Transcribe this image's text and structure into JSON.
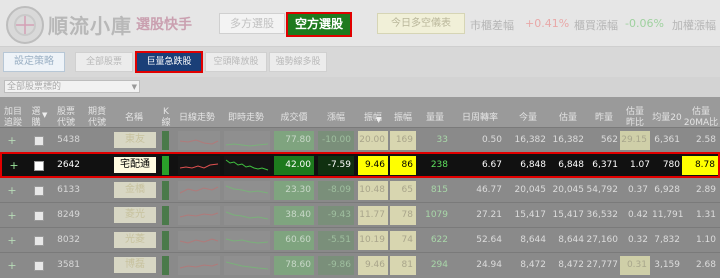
{
  "app": {
    "brand": "順流小庫",
    "brand_sub": "選股快手"
  },
  "top_tabs": {
    "long": "多方選股",
    "short": "空方選股"
  },
  "summary_button": "今日多空儀表",
  "stats": [
    {
      "label": "市櫃差幅",
      "value": "+0.41%",
      "color": "#e8a8a8"
    },
    {
      "label": "櫃買漲幅",
      "value": "-0.06%",
      "color": "#9fd19f"
    }
  ],
  "settings_label": "加權漲幅",
  "strategy_button": "設定策略",
  "subtabs": [
    {
      "label": "全部股票",
      "active": false
    },
    {
      "label": "巨量急跌股",
      "active": true
    },
    {
      "label": "空頭降放股",
      "active": false
    },
    {
      "label": "強勢線多股",
      "active": false
    }
  ],
  "stock_select": {
    "value": "全部股票標的"
  },
  "columns": [
    "加目\n追蹤",
    "選\n購",
    "股票\n代號",
    "期貨\n代號",
    "名稱",
    "K\n線",
    "日線走勢",
    "即時走勢",
    "成交價",
    "漲幅",
    "振幅",
    "振幅",
    "量量",
    "日周轉率",
    "今量",
    "估量",
    "昨量",
    "估量\n昨比",
    "均量20",
    "估量\n20MA比"
  ],
  "rows": [
    {
      "code": "5438",
      "name": "東友",
      "price": "77.80",
      "chg": "-10.00",
      "amp": "20.00",
      "amp2": "169",
      "vol_ratio": "33",
      "turnover": "0.50",
      "today": "16,382",
      "est": "16,382",
      "yest": "562",
      "est_yest": "29.15",
      "ma20": "6,361",
      "est_ma": "2.58",
      "selected": false
    },
    {
      "code": "2642",
      "name": "宅配通",
      "price": "42.00",
      "chg": "-7.59",
      "amp": "9.46",
      "amp2": "86",
      "vol_ratio": "238",
      "turnover": "6.67",
      "today": "6,848",
      "est": "6,848",
      "yest": "6,371",
      "est_yest": "1.07",
      "ma20": "780",
      "est_ma": "8.78",
      "selected": true
    },
    {
      "code": "6133",
      "name": "金橋",
      "price": "23.30",
      "chg": "-8.09",
      "amp": "10.48",
      "amp2": "65",
      "vol_ratio": "815",
      "turnover": "46.77",
      "today": "20,045",
      "est": "20,045",
      "yest": "54,792",
      "est_yest": "0.37",
      "ma20": "6,928",
      "est_ma": "2.89",
      "selected": false
    },
    {
      "code": "8249",
      "name": "菱光",
      "price": "38.40",
      "chg": "-9.43",
      "amp": "11.77",
      "amp2": "78",
      "vol_ratio": "1079",
      "turnover": "27.21",
      "today": "15,417",
      "est": "15,417",
      "yest": "36,532",
      "est_yest": "0.42",
      "ma20": "11,791",
      "est_ma": "1.31",
      "selected": false
    },
    {
      "code": "8032",
      "name": "光菱",
      "price": "60.60",
      "chg": "-5.51",
      "amp": "10.19",
      "amp2": "74",
      "vol_ratio": "622",
      "turnover": "52.64",
      "today": "8,644",
      "est": "8,644",
      "yest": "27,160",
      "est_yest": "0.32",
      "ma20": "7,832",
      "est_ma": "1.10",
      "selected": false
    },
    {
      "code": "3581",
      "name": "博磊",
      "price": "78.60",
      "chg": "-9.86",
      "amp": "9.46",
      "amp2": "81",
      "vol_ratio": "294",
      "turnover": "24.94",
      "today": "8,472",
      "est": "8,472",
      "yest": "27,777",
      "est_yest": "0.31",
      "ma20": "3,159",
      "est_ma": "2.68",
      "selected": false
    }
  ]
}
